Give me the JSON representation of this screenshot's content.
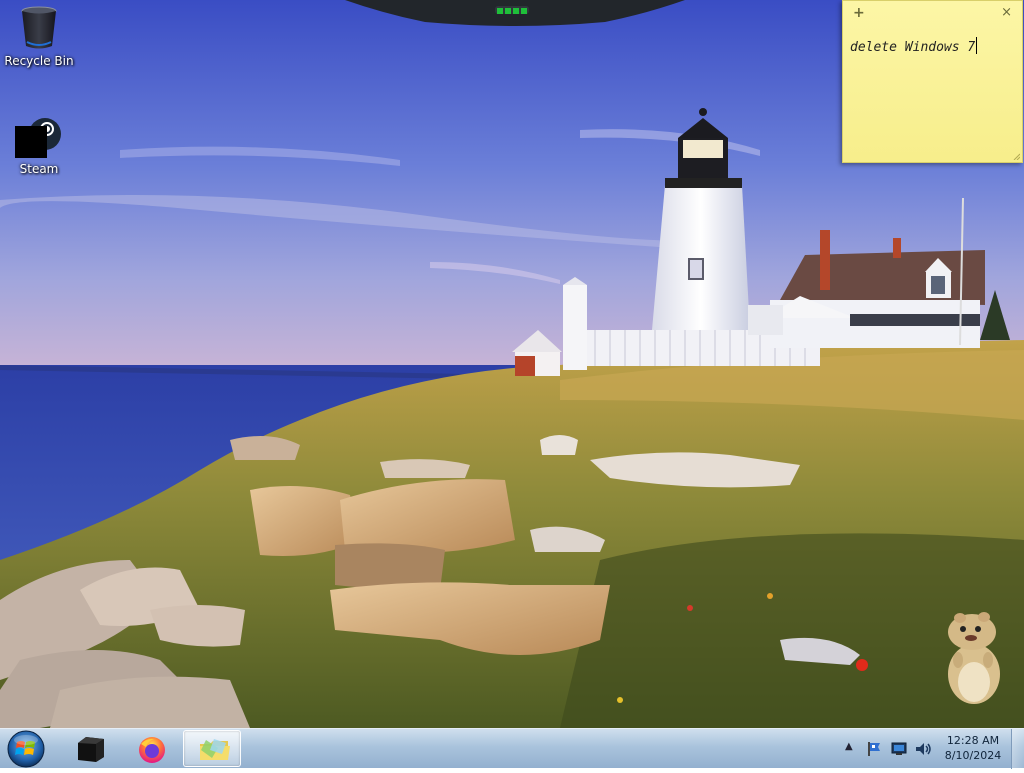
{
  "desktop": {
    "icons": [
      {
        "label": "Recycle Bin",
        "icon": "recycle-bin-icon"
      },
      {
        "label": "Steam",
        "icon": "steam-icon"
      }
    ]
  },
  "sticky_note": {
    "text": "delete Windows 7",
    "add_glyph": "+",
    "close_glyph": "×"
  },
  "taskbar": {
    "start_icon": "windows-orb-icon",
    "pinned": [
      {
        "name": "black-box-app",
        "icon": "black-cube-icon"
      },
      {
        "name": "firefox",
        "icon": "firefox-icon"
      },
      {
        "name": "windows-explorer",
        "icon": "folder-icon",
        "active": true
      }
    ],
    "tray": {
      "chevron": "▲",
      "icons": [
        "flag-icon",
        "network-icon",
        "volume-icon"
      ]
    },
    "clock": {
      "time": "12:28 AM",
      "date": "8/10/2024"
    }
  },
  "colors": {
    "sky_top": "#3d4fc0",
    "sea": "#2b3fa0",
    "sticky": "#fbf3a0",
    "taskbar": "#a9c3dc"
  }
}
